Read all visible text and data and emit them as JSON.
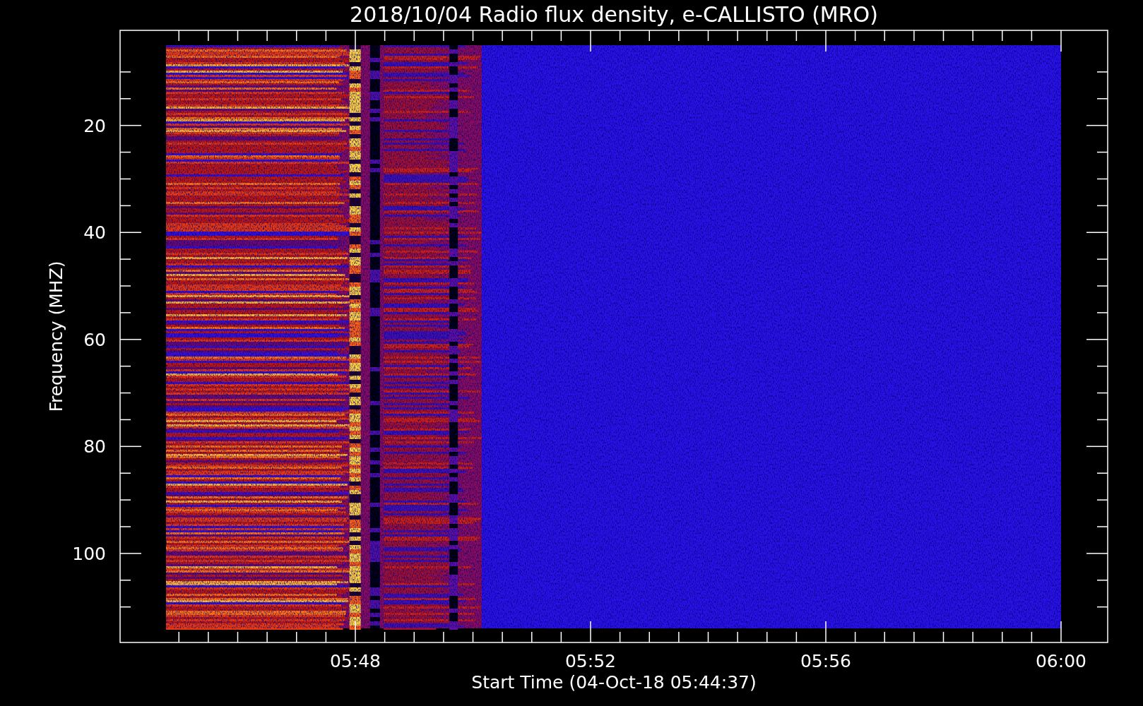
{
  "title": "2018/10/04  Radio flux density, e-CALLISTO (MRO)",
  "y_axis": {
    "label": "Frequency (MHZ)",
    "ticks": [
      "20",
      "40",
      "60",
      "80",
      "100"
    ]
  },
  "x_axis": {
    "label": "Start Time (04-Oct-18 05:44:37)",
    "ticks": [
      "05:48",
      "05:52",
      "05:56",
      "06:00"
    ]
  }
}
